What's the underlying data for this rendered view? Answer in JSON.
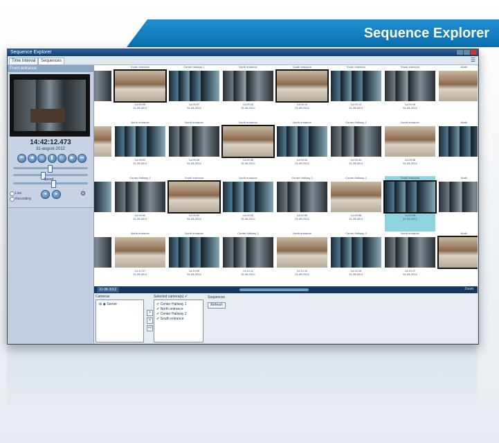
{
  "banner": {
    "title": "Sequence Explorer"
  },
  "window": {
    "title": "Sequence Explorer",
    "tabs": [
      "Time Interval",
      "Sequences"
    ]
  },
  "left": {
    "header": "Front entrance",
    "time": "14:42:12.473",
    "date": "31-august-2012",
    "controls": [
      "prev-sequence",
      "step-back",
      "play-reverse",
      "pause",
      "play",
      "step-forward",
      "next-sequence"
    ],
    "speed_label": "Speed",
    "options": [
      "Live",
      "Recording"
    ]
  },
  "grid": {
    "rows": [
      {
        "labels": [
          "",
          "South entrance",
          "Center Hallway 1",
          "North entrance",
          "South entrance",
          "South entrance",
          "South entrance",
          "North"
        ],
        "times": [
          "",
          "14:09:05\n31-08-2012",
          "14:09:07\n31-08-2012",
          "14:09:09\n31-08-2012",
          "14:09:11\n31-08-2012",
          "14:09:13\n31-08-2012",
          "14:09:15\n31-08-2012",
          ""
        ]
      },
      {
        "labels": [
          "",
          "North entrance",
          "North entrance",
          "North entrance",
          "North entrance",
          "Center Hallway 1",
          "North entrance",
          "North"
        ],
        "times": [
          "",
          "14:09:22\n31-08-2012",
          "14:09:24\n31-08-2012",
          "14:09:30\n31-08-2012",
          "14:09:32\n31-08-2012",
          "14:09:34\n31-08-2012",
          "14:09:36\n31-08-2012",
          ""
        ]
      },
      {
        "labels": [
          "",
          "Center Hallway 1",
          "South entrance",
          "North entrance",
          "Center Hallway 2",
          "Center Hallway 2",
          "South entrance",
          "North"
        ],
        "times": [
          "",
          "14:09:50\n31-08-2012",
          "14:09:52\n31-08-2012",
          "14:09:53\n31-08-2012",
          "14:09:55\n31-08-2012",
          "14:09:56\n31-08-2012",
          "14:09:58\n31-08-2012",
          ""
        ]
      },
      {
        "labels": [
          "",
          "North entrance",
          "North entrance",
          "Center Hallway 2",
          "North entrance",
          "Center Hallway 2",
          "North entrance",
          "North"
        ],
        "times": [
          "",
          "14:10:07\n31-08-2012",
          "14:10:09\n31-08-2012",
          "14:10:11\n31-08-2012",
          "14:10:13\n31-08-2012",
          "14:10:15\n31-08-2012",
          "14:10:17\n31-08-2012",
          ""
        ]
      }
    ]
  },
  "timeline": {
    "date": "31-08-2012",
    "zoom_label": "Zoom"
  },
  "bottom": {
    "cameras_title": "Cameras",
    "server_label": "Server",
    "selected_title": "Selected camera(s)",
    "selected": [
      "Center Hallway 1",
      "North entrance",
      "Center Hallway 2",
      "South entrance"
    ],
    "sequences_title": "Sequences",
    "refresh_label": "Refresh",
    "arrow_add": ">",
    "arrow_remove": "<",
    "arrow_remove_all": "<<"
  }
}
